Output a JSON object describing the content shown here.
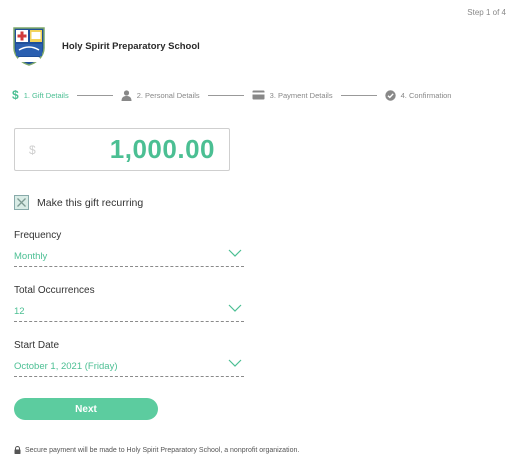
{
  "header": {
    "step_count": "Step 1 of 4",
    "school_name": "Holy Spirit Preparatory School",
    "crest_text": "Holy Spirit"
  },
  "steps": [
    {
      "number": "1.",
      "label": "Gift Details",
      "icon": "dollar-icon",
      "active": true
    },
    {
      "number": "2.",
      "label": "Personal Details",
      "icon": "user-icon",
      "active": false
    },
    {
      "number": "3.",
      "label": "Payment Details",
      "icon": "credit-card-icon",
      "active": false
    },
    {
      "number": "4.",
      "label": "Confirmation",
      "icon": "check-circle-icon",
      "active": false
    }
  ],
  "steps_text": {
    "s1": "1. Gift Details",
    "s2": "2. Personal Details",
    "s3": "3. Payment Details",
    "s4": "4. Confirmation"
  },
  "amount": {
    "currency_symbol": "$",
    "value": "1,000.00"
  },
  "recurring": {
    "label": "Make this gift recurring",
    "checked": true
  },
  "frequency": {
    "label": "Frequency",
    "value": "Monthly"
  },
  "occurrences": {
    "label": "Total Occurrences",
    "value": "12"
  },
  "start_date": {
    "label": "Start Date",
    "value": "October 1, 2021 (Friday)"
  },
  "next_button": "Next",
  "secure_note": "Secure payment will be made to Holy Spirit Preparatory School, a nonprofit organization.",
  "colors": {
    "accent": "#4bbf93",
    "button": "#5ccc9f",
    "crest_blue": "#1f4f9a",
    "crest_red": "#d23b3b"
  }
}
